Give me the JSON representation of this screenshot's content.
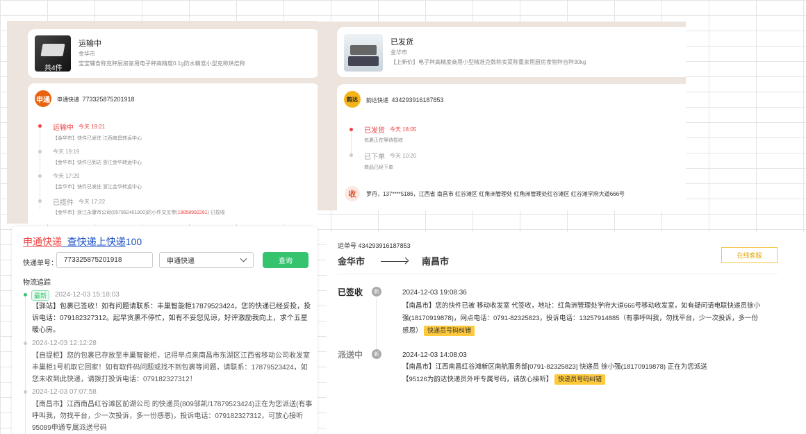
{
  "p1": {
    "item": {
      "thumb_label": "共4件",
      "status": "运输中",
      "shop": "金华市",
      "desc": "宝宝辅食称克秤厨房家用电子秤高精度0.1g防水精准小型克称烘焙称"
    },
    "carrier": {
      "logo": "申通",
      "name": "申通快递",
      "number": "773325875201918"
    },
    "timeline": [
      {
        "status": "运输中",
        "time": "今天 19:21",
        "note": "【金华市】快件已发往 江西南昌转运中心"
      },
      {
        "status": "",
        "time": "今天 19:19",
        "note": "【金华市】快件已到达 浙江金华转运中心"
      },
      {
        "status": "",
        "time": "今天 17:29",
        "note": "【金华市】快件已发往 浙江金华转运中心"
      },
      {
        "status": "已揽件",
        "time": "今天 17:22",
        "note": "【金华市】浙江永康市公司(057982401900)的小件交叉带(",
        "phone": "18858992261",
        "note_end": ") 已揽收"
      }
    ]
  },
  "p2": {
    "item": {
      "status": "已发货",
      "shop": "金华市",
      "desc": "【上新价】电子秤高精度商用小型精准克数称卖菜称重家用厨房食物秤台秤30kg"
    },
    "carrier": {
      "logo": "韵达",
      "name": "韵达快递",
      "number": "434293916187853"
    },
    "timeline": [
      {
        "status": "已发货",
        "time": "今天 18:05",
        "note": "包裹正在等待揽收"
      },
      {
        "status": "已下单",
        "time": "今天 10:20",
        "note": "商品已经下单"
      }
    ],
    "receiver": {
      "icon": "收",
      "text": "罗丹，137****5186，江西省 南昌市 红谷滩区 红角洲管理处 红角洲管理处红谷滩区 红谷滩学府大道666号"
    }
  },
  "p3": {
    "title": {
      "a": "申通快递",
      "sep": "_",
      "b": "查快递上快递",
      "c": "100"
    },
    "form": {
      "label": "快递单号：",
      "number": "773325875201918",
      "carrier": "申通快递",
      "query": "查询"
    },
    "section": "物流追踪",
    "entries": [
      {
        "badge": "最新",
        "time": "2024-12-03 15:18:03",
        "text": "【驿站】包裹已签收！如有问题请联系：丰巢智能柜17879523424，您的快递已经妥投，投诉电话：079182327312。起早贪黑不停忙，如有不妥您见谅，好评激励我向上，求个五星暖心房。"
      },
      {
        "time": "2024-12-03 12:12:28",
        "text": "【自提柜】您的包裹已存放至丰巢智能柜，记得早点来南昌市东湖区江西省移动公司收发室丰巢柜1号机取它回家！如有取件码问题或找不到包裹等问题，请联系：17879523424，如您未收到此快递，请拨打投诉电话：079182327312！"
      },
      {
        "time": "2024-12-03 07:07:58",
        "text": "【南昌市】江西南昌红谷滩区前湖公司 的快递员(809邬凯/17879523424)正在为您派送(有事呼叫我，勿找平台，少一次投诉，多一份感恩)，投诉电话：079182327312，可放心接听95089申通专属派送号码"
      }
    ]
  },
  "p4": {
    "waybill": "运单号 434293916187853",
    "from": "金华市",
    "to": "南昌市",
    "service": "在线客服",
    "events": [
      {
        "state": "已签收",
        "badge": "新",
        "time": "2024-12-03 19:08:36",
        "text": "【南昌市】您的快件已被 移动收发室 代签收，地址：红角洲管理处学府大道666号移动收发室，如有疑问请电联快递员徐小强(18170919878)，网点电话：0791-82325823，投诉电话：13257914885（有事呼叫我，勿找平台，少一次投诉，多一份感恩）",
        "tag": "快递员号码纠错"
      },
      {
        "state": "派送中",
        "badge": "新",
        "time": "2024-12-03 14:08:03",
        "text": "【南昌市】江西南昌红谷滩新区南航服务部[0791-82325823] 快递员 徐小强(18170919878) 正在为您派送",
        "text2": "【95126为韵达快递员外呼专属号码，请放心接听】",
        "tag": "快递员号码纠错"
      }
    ]
  }
}
